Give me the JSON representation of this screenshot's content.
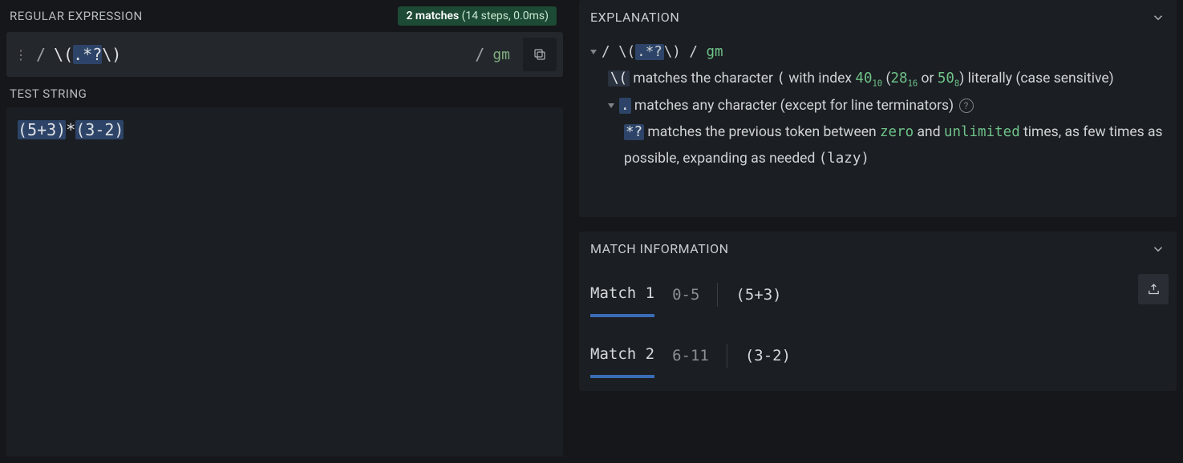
{
  "regex_section": {
    "title": "REGULAR EXPRESSION",
    "matches_badge": {
      "count_label": "2 matches",
      "detail": "(14 steps, 0.0ms)"
    },
    "delimiter": "/",
    "pattern_pre": "\\(",
    "pattern_hl": ".*?",
    "pattern_post": "\\)",
    "flags": "gm"
  },
  "test_section": {
    "title": "TEST STRING",
    "seg1": "(5+3)",
    "seg2": "*",
    "seg3": "(3-2)"
  },
  "explanation": {
    "title": "EXPLANATION",
    "line_regex_pre": "/ ",
    "line_regex_pat_pre": "\\(",
    "line_regex_pat_hl": ".*?",
    "line_regex_pat_post": "\\)",
    "line_regex_mid": " / ",
    "line_regex_flags": "gm",
    "l1_chip": "\\(",
    "l1_text_a": " matches the character ",
    "l1_char": "(",
    "l1_text_b": " with index ",
    "l1_n1": "40",
    "l1_b1": "10",
    "l1_mid1": " (",
    "l1_n2": "28",
    "l1_b2": "16",
    "l1_or": " or ",
    "l1_n3": "50",
    "l1_b3": "8",
    "l1_text_c": ") literally (case sensitive)",
    "l2_chip": ".",
    "l2_text": " matches any character (except for line terminators) ",
    "l3_chip": "*?",
    "l3_text_a": " matches the previous token between ",
    "l3_zero": "zero",
    "l3_and": " and ",
    "l3_unl": "unlimited",
    "l3_text_b": " times, as few times as possible, expanding as needed ",
    "l3_lazy": "(lazy)"
  },
  "match_info": {
    "title": "MATCH INFORMATION",
    "rows": [
      {
        "label": "Match 1",
        "range": "0-5",
        "text": "(5+3)"
      },
      {
        "label": "Match 2",
        "range": "6-11",
        "text": "(3-2)"
      }
    ]
  }
}
